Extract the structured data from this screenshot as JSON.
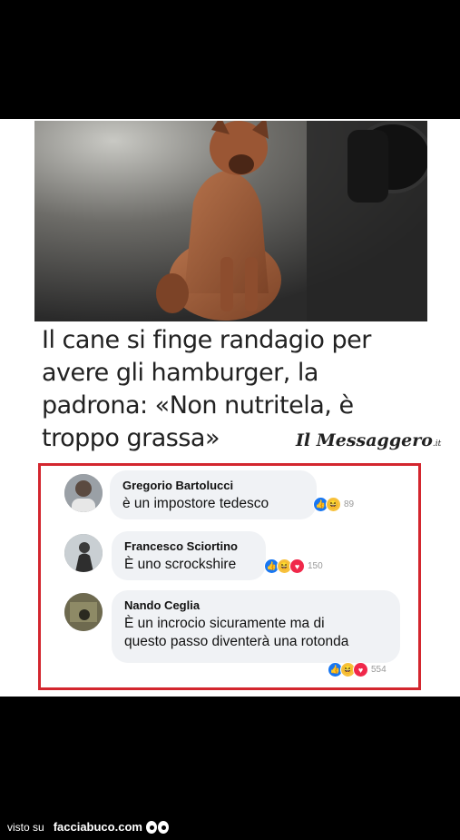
{
  "headline": {
    "line1": "Il cane si finge randagio per",
    "line2": "avere gli hamburger, la",
    "line3": "padrona: «Non nutritela, è",
    "line4": "troppo grassa»"
  },
  "source_logo": "Il Messaggero",
  "source_logo_suffix": ".it",
  "comments": [
    {
      "name": "Gregorio Bartolucci",
      "text": "è un impostore tedesco",
      "reactions": [
        "like-icon",
        "haha-icon"
      ],
      "count": "89"
    },
    {
      "name": "Francesco Sciortino",
      "text": "È uno scrockshire",
      "reactions": [
        "like-icon",
        "haha-icon",
        "love-icon"
      ],
      "count": "150"
    },
    {
      "name": "Nando Ceglia",
      "text_line1": "È un incrocio sicuramente ma di",
      "text_line2": "questo passo diventerà una rotonda",
      "reactions": [
        "like-icon",
        "haha-icon",
        "love-icon"
      ],
      "count": "554"
    }
  ],
  "footer": {
    "prefix": "visto su",
    "brand": "facciabuco.com"
  },
  "colors": {
    "highlight_border": "#d3262e",
    "like": "#1877f2",
    "haha": "#f7c13c",
    "love": "#f0284a"
  }
}
